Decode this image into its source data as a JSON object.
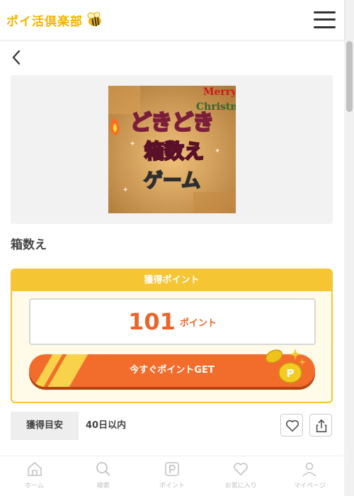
{
  "header": {
    "logo_text": "ポイ活倶楽部",
    "logo_icon": "bee-icon",
    "menu_icon": "hamburger-menu-icon"
  },
  "nav": {
    "back_icon": "chevron-left-icon"
  },
  "banner": {
    "line1": "どきどき",
    "line2": "箱数え",
    "line3": "ゲーム",
    "deco_text_1": "Merry",
    "deco_text_2": "Christmas"
  },
  "offer": {
    "title": "箱数え",
    "panel_header": "獲得ポイント",
    "points": "101",
    "points_unit": "ポイント",
    "cta_label": "今すぐポイントGET"
  },
  "info": {
    "label": "獲得目安",
    "value": "40日以内",
    "favorite_icon": "heart-icon",
    "share_icon": "share-icon"
  },
  "tabbar": {
    "items": [
      {
        "label": "ホーム",
        "icon": "home-icon"
      },
      {
        "label": "検索",
        "icon": "search-icon"
      },
      {
        "label": "ポイント",
        "icon": "point-icon"
      },
      {
        "label": "お気に入り",
        "icon": "heart-icon"
      },
      {
        "label": "マイページ",
        "icon": "user-icon"
      }
    ]
  },
  "colors": {
    "brand_yellow": "#f4b400",
    "panel_yellow": "#f6c533",
    "cta_orange": "#f26d2c",
    "points_orange": "#e8662a"
  }
}
